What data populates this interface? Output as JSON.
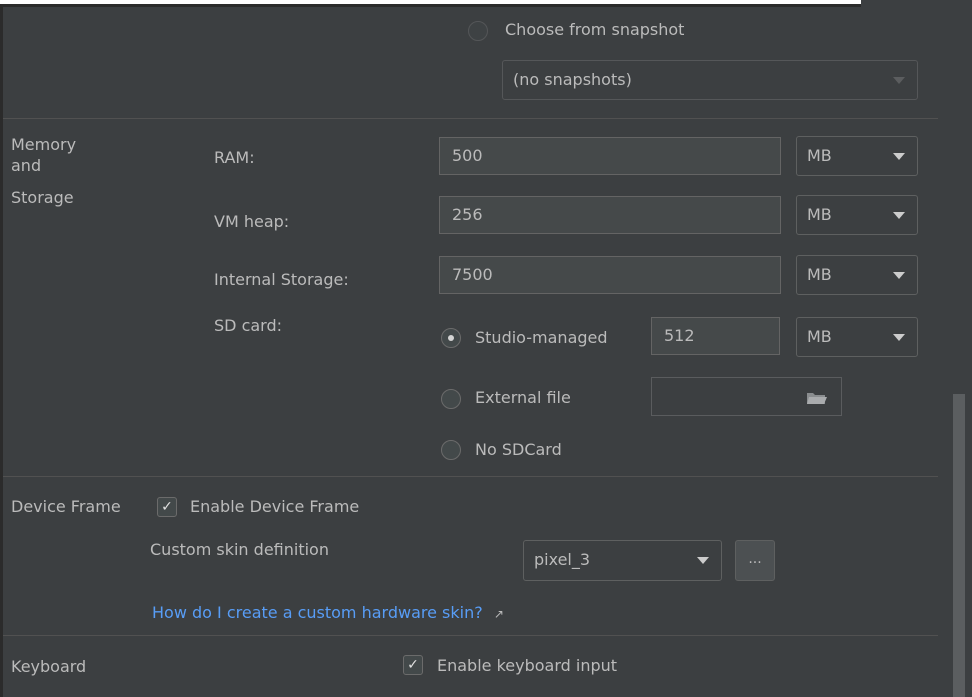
{
  "snapshot": {
    "radio_label": "Choose from snapshot",
    "select_value": "(no snapshots)"
  },
  "memory": {
    "section_label_line1": "Memory",
    "section_label_line2": "and",
    "section_label_line3": "Storage",
    "ram_label": "RAM:",
    "ram_value": "500",
    "ram_unit": "MB",
    "vm_heap_label": "VM heap:",
    "vm_heap_value": "256",
    "vm_heap_unit": "MB",
    "internal_label": "Internal Storage:",
    "internal_value": "7500",
    "internal_unit": "MB",
    "sdcard_label": "SD card:",
    "studio_managed_label": "Studio-managed",
    "studio_managed_value": "512",
    "studio_managed_unit": "MB",
    "external_file_label": "External file",
    "external_file_value": "",
    "no_sdcard_label": "No SDCard"
  },
  "device_frame": {
    "section_label": "Device Frame",
    "enable_label": "Enable Device Frame",
    "enabled": true,
    "custom_skin_label": "Custom skin definition",
    "skin_value": "pixel_3",
    "browse_label": "...",
    "help_link": "How do I create a custom hardware skin?",
    "help_link_arrow": "↗"
  },
  "keyboard": {
    "section_label": "Keyboard",
    "enable_label": "Enable keyboard input",
    "enabled": true
  },
  "colors": {
    "background": "#3c3f41",
    "text": "#bbbbbb",
    "link": "#589df6",
    "field_bg": "#45494a"
  }
}
